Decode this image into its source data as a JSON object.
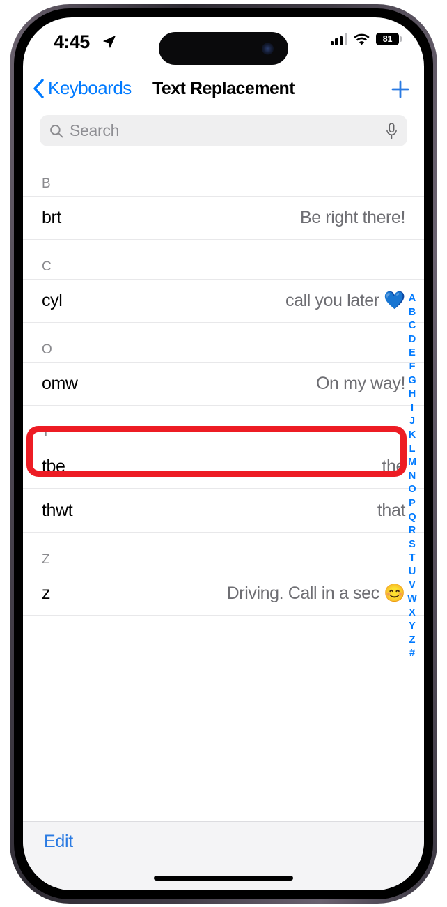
{
  "status_bar": {
    "time": "4:45",
    "location_icon": "location-arrow-icon",
    "cellular_icon": "cellular-signal-icon",
    "wifi_icon": "wifi-icon",
    "battery_level": "81"
  },
  "nav_bar": {
    "back_label": "Keyboards",
    "back_icon": "chevron-left-icon",
    "title": "Text Replacement",
    "add_icon": "plus-icon"
  },
  "search": {
    "placeholder": "Search",
    "value": "",
    "search_icon": "search-icon",
    "dictate_icon": "microphone-icon"
  },
  "sections": [
    {
      "header": "B",
      "rows": [
        {
          "shortcut": "brt",
          "phrase": "Be right there!",
          "highlighted": false
        }
      ]
    },
    {
      "header": "C",
      "rows": [
        {
          "shortcut": "cyl",
          "phrase": "call you later 💙",
          "highlighted": false
        }
      ]
    },
    {
      "header": "O",
      "rows": [
        {
          "shortcut": "omw",
          "phrase": "On my way!",
          "highlighted": true
        }
      ]
    },
    {
      "header": "T",
      "rows": [
        {
          "shortcut": "tbe",
          "phrase": "the",
          "highlighted": false
        },
        {
          "shortcut": "thwt",
          "phrase": "that",
          "highlighted": false
        }
      ]
    },
    {
      "header": "Z",
      "rows": [
        {
          "shortcut": "z",
          "phrase": "Driving. Call in a sec 😊",
          "highlighted": false
        }
      ]
    }
  ],
  "alphabet_index": [
    "A",
    "B",
    "C",
    "D",
    "E",
    "F",
    "G",
    "H",
    "I",
    "J",
    "K",
    "L",
    "M",
    "N",
    "O",
    "P",
    "Q",
    "R",
    "S",
    "T",
    "U",
    "V",
    "W",
    "X",
    "Y",
    "Z",
    "#"
  ],
  "toolbar": {
    "edit_label": "Edit"
  },
  "colors": {
    "accent_blue": "#007aff",
    "edit_blue": "#2a7ae2",
    "highlight_red": "#ed1c24",
    "secondary_text": "#6e6e73",
    "header_text": "#8a8a8e",
    "search_bg": "#efeff0",
    "toolbar_bg": "#f4f4f6"
  }
}
